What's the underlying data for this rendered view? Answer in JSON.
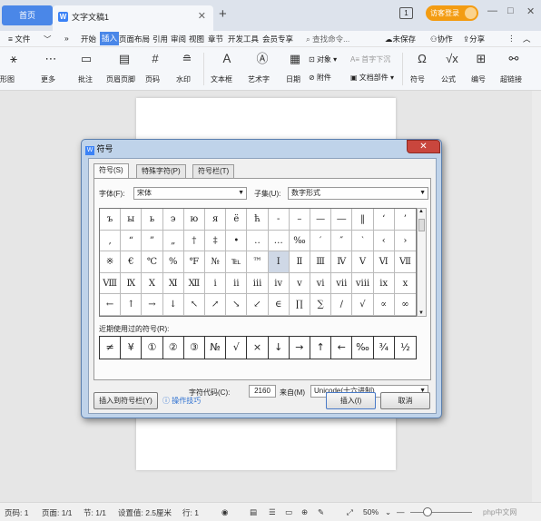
{
  "tabs": {
    "home": "首页",
    "doc": "文字文稿1",
    "doc_icon": "W",
    "add": "+"
  },
  "titlebar": {
    "window_num": "1",
    "login": "访客登录",
    "min": "—",
    "restore": "□",
    "close": "✕"
  },
  "menu": {
    "file": "≡ 文件",
    "arrow1": "﹀",
    "more": "»",
    "items": [
      "开始",
      "插入",
      "页面布局",
      "引用",
      "审阅",
      "视图",
      "章节",
      "开发工具",
      "会员专享"
    ],
    "search": "查找命令...",
    "unsaved": "未保存",
    "collab": "协作",
    "share": "分享",
    "dots": "⋮",
    "caret": "︿"
  },
  "ribbon": {
    "left_cut": "形图",
    "more": "更多",
    "comment": "批注",
    "header_footer": "页眉页脚",
    "page_num": "页码",
    "watermark": "水印",
    "textbox": "文本框",
    "wordart": "艺术字",
    "date": "日期",
    "object": "对象",
    "attach": "附件",
    "dropcap": "首字下沉",
    "docpart": "文档部件",
    "symbol": "符号",
    "formula": "公式",
    "numbering": "编号",
    "hyperlink": "超链接"
  },
  "dialog": {
    "title": "符号",
    "close": "✕",
    "tabs": [
      "符号(S)",
      "特殊字符(P)",
      "符号栏(T)"
    ],
    "font_label": "字体(F):",
    "font_value": "宋体",
    "subset_label": "子集(U):",
    "subset_value": "数字形式",
    "symbols": [
      [
        "ъ",
        "ы",
        "ь",
        "э",
        "ю",
        "я",
        "ё",
        "ћ",
        "-",
        "–",
        "—",
        "―",
        "‖",
        "‘",
        "’"
      ],
      [
        "‚",
        "“",
        "”",
        "„",
        "†",
        "‡",
        "•",
        "‥",
        "…",
        "‰",
        "′",
        "″",
        "‵",
        "‹",
        "›"
      ],
      [
        "※",
        "€",
        "℃",
        "%",
        "℉",
        "№",
        "℡",
        "™",
        "Ⅰ",
        "Ⅱ",
        "Ⅲ",
        "Ⅳ",
        "Ⅴ",
        "Ⅵ",
        "Ⅶ"
      ],
      [
        "Ⅷ",
        "Ⅸ",
        "Ⅹ",
        "Ⅺ",
        "Ⅻ",
        "ⅰ",
        "ⅱ",
        "ⅲ",
        "ⅳ",
        "ⅴ",
        "ⅵ",
        "ⅶ",
        "ⅷ",
        "ⅸ",
        "ⅹ"
      ],
      [
        "←",
        "↑",
        "→",
        "↓",
        "↖",
        "↗",
        "↘",
        "↙",
        "∈",
        "∏",
        "∑",
        "∕",
        "√",
        "∝",
        "∞"
      ]
    ],
    "recent_label": "近期使用过的符号(R):",
    "recent": [
      "≠",
      "¥",
      "①",
      "②",
      "③",
      "№",
      "√",
      "×",
      "↓",
      "→",
      "↑",
      "←",
      "‰",
      "¾",
      "½"
    ],
    "code_label": "字符代码(C):",
    "code_value": "2160",
    "from_label": "来自(M)",
    "from_value": "Unicode(十六进制)",
    "insert_to_bar": "插入到符号栏(Y)",
    "tips": "操作技巧",
    "insert": "插入(I)",
    "cancel": "取消"
  },
  "status": {
    "page_num": "页码: 1",
    "page": "页面: 1/1",
    "section": "节: 1/1",
    "setting": "设置值: 2.5厘米",
    "row": "行: 1",
    "zoom": "50%",
    "watermark": "php中文网"
  }
}
